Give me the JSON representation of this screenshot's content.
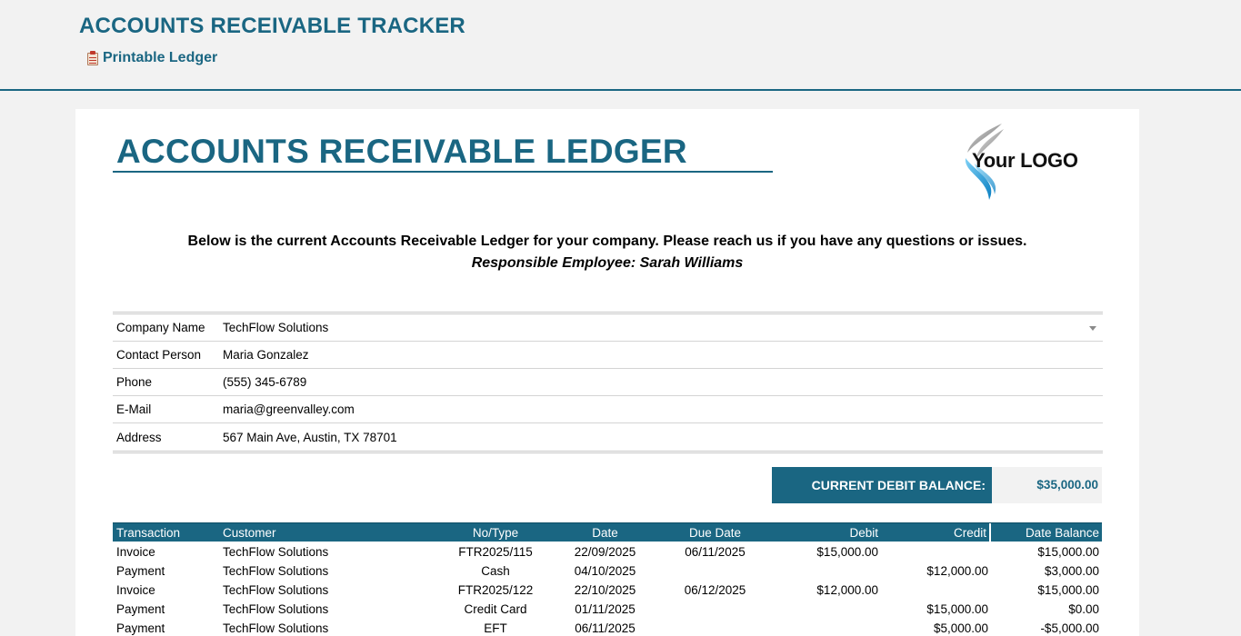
{
  "app": {
    "title": "ACCOUNTS RECEIVABLE TRACKER",
    "link_label": "Printable Ledger",
    "link_icon": "clipboard-icon"
  },
  "ledger": {
    "title": "ACCOUNTS RECEIVABLE LEDGER",
    "logo_text": "Your LOGO",
    "intro": "Below is the current Accounts Receivable Ledger for your company. Please reach us if you have any questions or issues.",
    "employee": "Responsible Employee: Sarah Williams"
  },
  "company": {
    "rows": [
      {
        "label": "Company Name",
        "value": "TechFlow Solutions"
      },
      {
        "label": "Contact Person",
        "value": "Maria Gonzalez"
      },
      {
        "label": "Phone",
        "value": "(555) 345-6789"
      },
      {
        "label": "E-Mail",
        "value": "maria@greenvalley.com"
      },
      {
        "label": "Address",
        "value": "567 Main Ave, Austin, TX 78701"
      }
    ]
  },
  "balance": {
    "label": "CURRENT DEBIT BALANCE:",
    "value": "$35,000.00"
  },
  "transactions": {
    "headers": [
      "Transaction",
      "Customer",
      "No/Type",
      "Date",
      "Due Date",
      "Debit",
      "Credit",
      "Date Balance"
    ],
    "rows": [
      [
        "Invoice",
        "TechFlow Solutions",
        "FTR2025/115",
        "22/09/2025",
        "06/11/2025",
        "$15,000.00",
        "",
        "$15,000.00"
      ],
      [
        "Payment",
        "TechFlow Solutions",
        "Cash",
        "04/10/2025",
        "",
        "",
        "$12,000.00",
        "$3,000.00"
      ],
      [
        "Invoice",
        "TechFlow Solutions",
        "FTR2025/122",
        "22/10/2025",
        "06/12/2025",
        "$12,000.00",
        "",
        "$15,000.00"
      ],
      [
        "Payment",
        "TechFlow Solutions",
        "Credit Card",
        "01/11/2025",
        "",
        "",
        "$15,000.00",
        "$0.00"
      ],
      [
        "Payment",
        "TechFlow Solutions",
        "EFT",
        "06/11/2025",
        "",
        "",
        "$5,000.00",
        "-$5,000.00"
      ]
    ]
  },
  "colors": {
    "accent": "#1a6682",
    "background": "#f2f2f2"
  }
}
